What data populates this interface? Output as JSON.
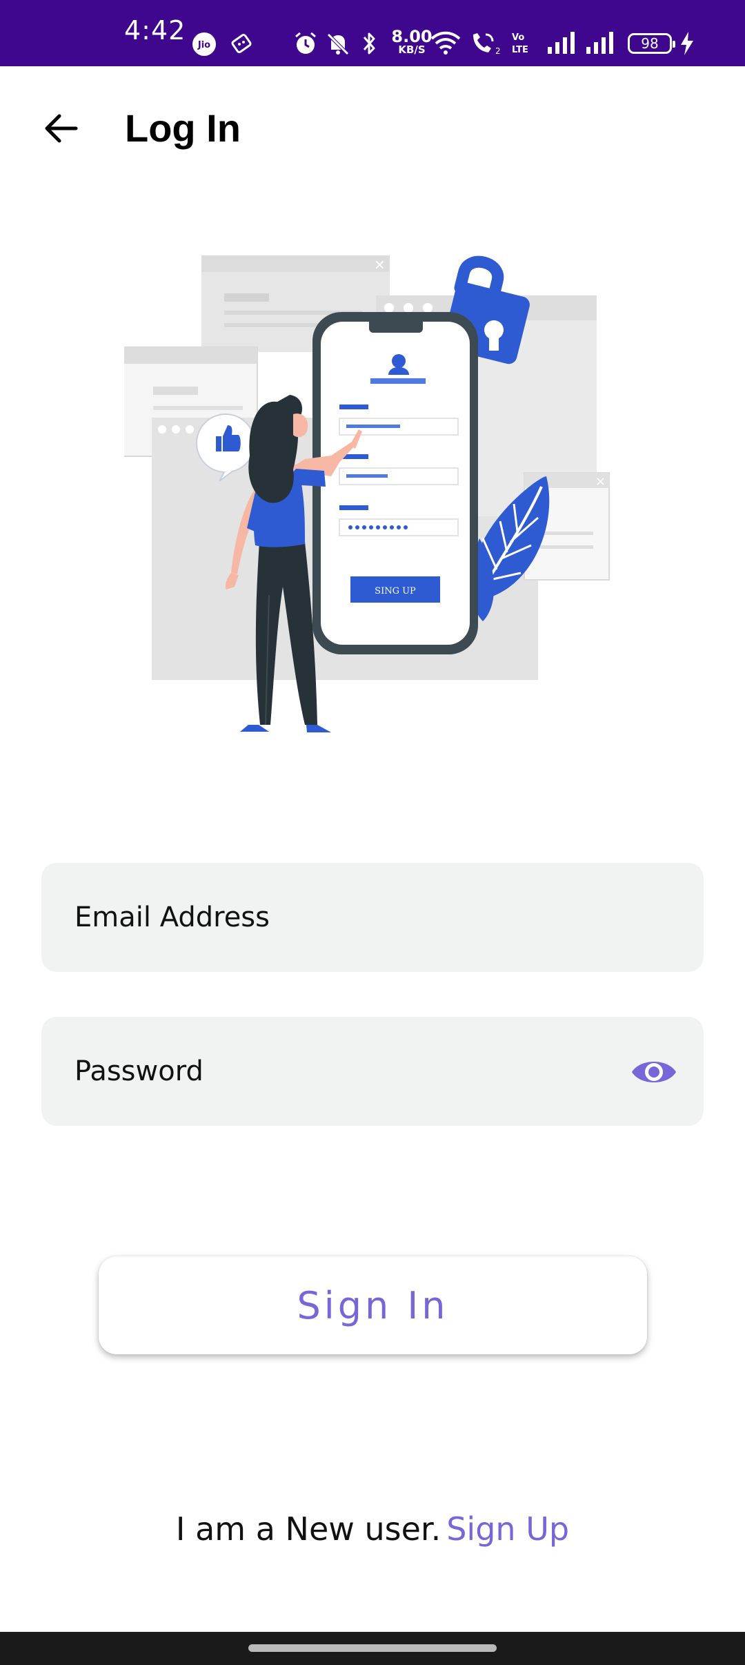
{
  "status_bar": {
    "time": "4:42",
    "net_speed_value": "8.00",
    "net_speed_unit": "KB/S",
    "battery_level": "98",
    "background_color": "#3e078d",
    "icons": [
      "jio-icon",
      "sim-icon",
      "alarm-icon",
      "mute-icon",
      "bluetooth-icon",
      "wifi-icon",
      "wifi-calling-icon",
      "volte-icon",
      "signal-icon",
      "signal-icon",
      "battery-icon",
      "charging-icon"
    ]
  },
  "header": {
    "title": "Log In",
    "back_icon": "arrow-left-icon"
  },
  "illustration": {
    "phone_button_label": "SING UP"
  },
  "form": {
    "email": {
      "placeholder": "Email Address",
      "value": ""
    },
    "password": {
      "placeholder": "Password",
      "value": "",
      "toggle_icon": "eye-icon"
    },
    "sign_in_label": "Sign In"
  },
  "footer": {
    "prompt": "I am a New user.",
    "link_label": "Sign Up"
  },
  "colors": {
    "accent": "#7766d8",
    "field_background": "#f1f2f2",
    "illustration_blue": "#2e5bd1"
  }
}
